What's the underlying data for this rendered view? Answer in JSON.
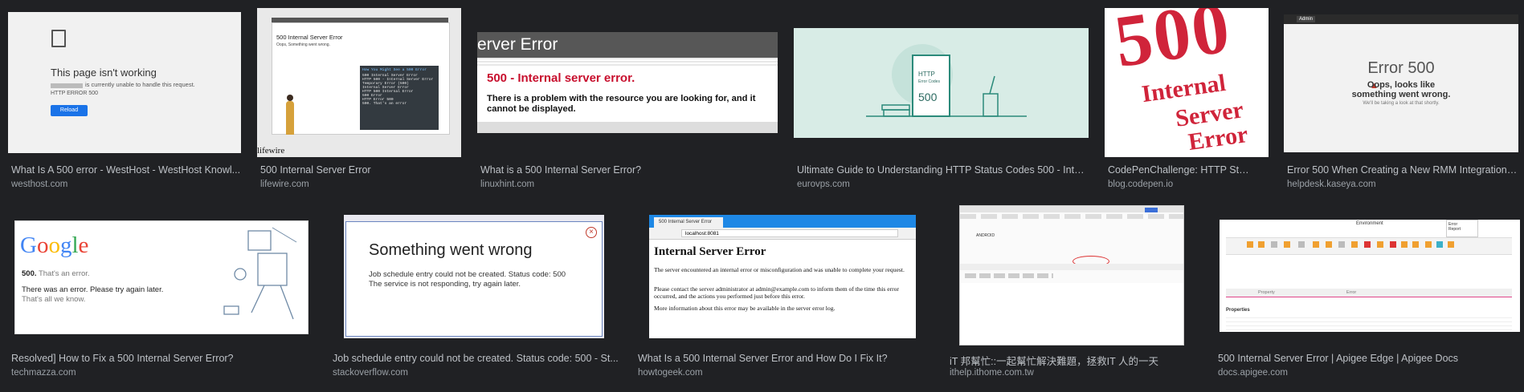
{
  "results": [
    {
      "caption": "What Is A 500 error - WestHost - WestHost Knowl...",
      "source": "westhost.com",
      "thumb": {
        "title": "This page isn't working",
        "line1": "is currently unable to handle this request.",
        "code": "HTTP ERROR 500",
        "button": "Reload"
      }
    },
    {
      "caption": "500 Internal Server Error",
      "source": "lifewire.com",
      "thumb": {
        "title": "500 Internal Server Error",
        "sub": "Oops, Something went wrong.",
        "box_title": "How You Might See a 500 Error",
        "box_lines": [
          "500 Internal Server Error",
          "HTTP 500 - Internal Server Error",
          "Temporary Error (500)",
          "Internal Server Error",
          "HTTP 500 Internal Error",
          "500 Error",
          "HTTP Error 500",
          "500. That's an error"
        ],
        "brand": "lifewire"
      }
    },
    {
      "caption": "What is a 500 Internal Server Error?",
      "source": "linuxhint.com",
      "thumb": {
        "header": "erver Error",
        "title": "500 - Internal server error.",
        "body": "There is a problem with the resource you are looking for, and it cannot be displayed."
      }
    },
    {
      "caption": "Ultimate Guide to Understanding HTTP Status Codes 500 - Inter...",
      "source": "eurovps.com",
      "thumb": {
        "book_top": "HTTP",
        "book_sub": "Error Codes",
        "book_num": "500"
      }
    },
    {
      "caption": "CodePenChallenge: HTTP Status ...",
      "source": "blog.codepen.io",
      "thumb": {
        "big": "500",
        "words": [
          "Internal",
          "Server",
          "Error"
        ]
      }
    },
    {
      "caption": "Error 500 When Creating a New RMM Integration i...",
      "source": "helpdesk.kaseya.com",
      "thumb": {
        "admin": "Admin",
        "title": "Error 500",
        "line1": "Oops, looks like",
        "line2": "something went wrong.",
        "line3": "We'll be taking a look at that shortly."
      }
    },
    {
      "caption": "Resolved] How to Fix a 500 Internal Server Error?",
      "source": "techmazza.com",
      "thumb": {
        "logo": [
          "G",
          "o",
          "o",
          "g",
          "l",
          "e"
        ],
        "line1_bold": "500.",
        "line1": "That's an error.",
        "line2_bold": "There was an error. Please try again later.",
        "line2": "That's all we know."
      }
    },
    {
      "caption": "Job schedule entry could not be created. Status code: 500 - St...",
      "source": "stackoverflow.com",
      "thumb": {
        "title": "Something went wrong",
        "line1": "Job schedule entry could not be created. Status code: 500",
        "line2": "The service is not responding, try again later."
      }
    },
    {
      "caption": "What Is a 500 Internal Server Error and How Do I Fix It?",
      "source": "howtogeek.com",
      "thumb": {
        "tab": "500 Internal Server Error",
        "url": "localhost:8081",
        "title": "Internal Server Error",
        "p1": "The server encountered an internal error or misconfiguration and was unable to complete your request.",
        "p2": "Please contact the server administrator at admin@example.com to inform them of the time this error occurred, and the actions you performed just before this error.",
        "p3": "More information about this error may be available in the server error log."
      }
    },
    {
      "caption": "iT 邦幫忙::一起幫忙解決難題，拯救IT 人的一天",
      "source": "ithelp.ithome.com.tw",
      "thumb": {
        "label": "ANDROID"
      }
    },
    {
      "caption": "500 Internal Server Error | Apigee Edge | Apigee Docs",
      "source": "docs.apigee.com",
      "thumb": {
        "env": "Environment",
        "popup_a": "Error",
        "popup_b": "Report",
        "col_a": "Property",
        "col_b": "Error",
        "props": "Properties"
      }
    }
  ],
  "colors": {
    "page_bg": "#202124",
    "caption": "#bdc1c6",
    "source": "#9aa0a6",
    "codepen_red": "#d0243a",
    "win_blue": "#1e88e5",
    "linux_red": "#c8102e"
  }
}
